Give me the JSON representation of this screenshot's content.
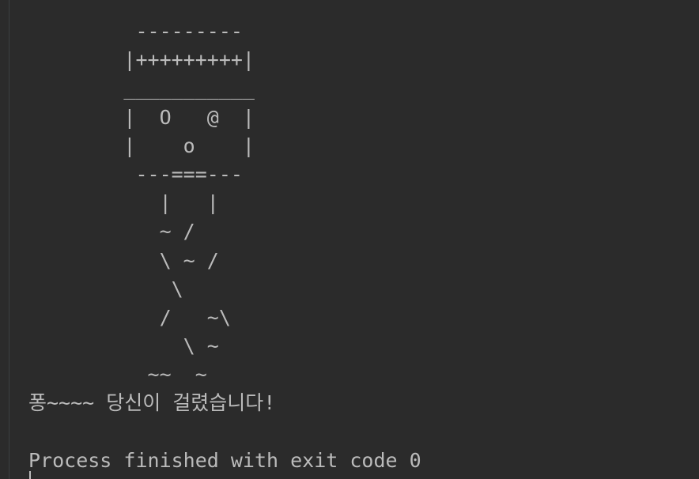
{
  "console": {
    "output_lines": [
      "         ---------",
      "        |+++++++++|",
      "        ___________",
      "        |  O   @  |",
      "        |    o    |",
      "         ---===---",
      "           |   |",
      "           ~ /",
      "           \\ ~ /",
      "            \\",
      "           /   ~\\",
      "             \\ ~",
      "          ~~  ~",
      "퐁~~~~ 당신이 걸렸습니다!",
      "",
      "Process finished with exit code 0"
    ]
  }
}
